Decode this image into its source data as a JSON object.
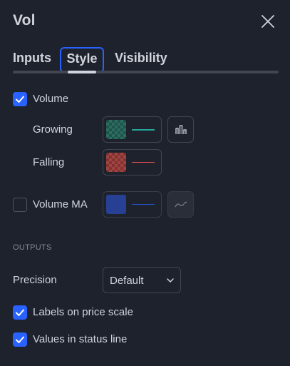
{
  "dialog": {
    "title": "Vol"
  },
  "tabs": [
    {
      "label": "Inputs"
    },
    {
      "label": "Style"
    },
    {
      "label": "Visibility"
    }
  ],
  "style": {
    "volume": {
      "label": "Volume",
      "checked": true
    },
    "growing": {
      "label": "Growing",
      "color": "#26a69a"
    },
    "falling": {
      "label": "Falling",
      "color": "#ef5350"
    },
    "volume_ma": {
      "label": "Volume MA",
      "checked": false,
      "color": "#2962ff"
    }
  },
  "outputs": {
    "heading": "OUTPUTS",
    "precision_label": "Precision",
    "precision_value": "Default",
    "labels_on_price_scale": {
      "label": "Labels on price scale",
      "checked": true
    },
    "values_in_status_line": {
      "label": "Values in status line",
      "checked": true
    }
  },
  "colors": {
    "background": "#1e222d",
    "accent": "#2962ff",
    "text": "#d1d4dc",
    "muted": "#868993"
  }
}
